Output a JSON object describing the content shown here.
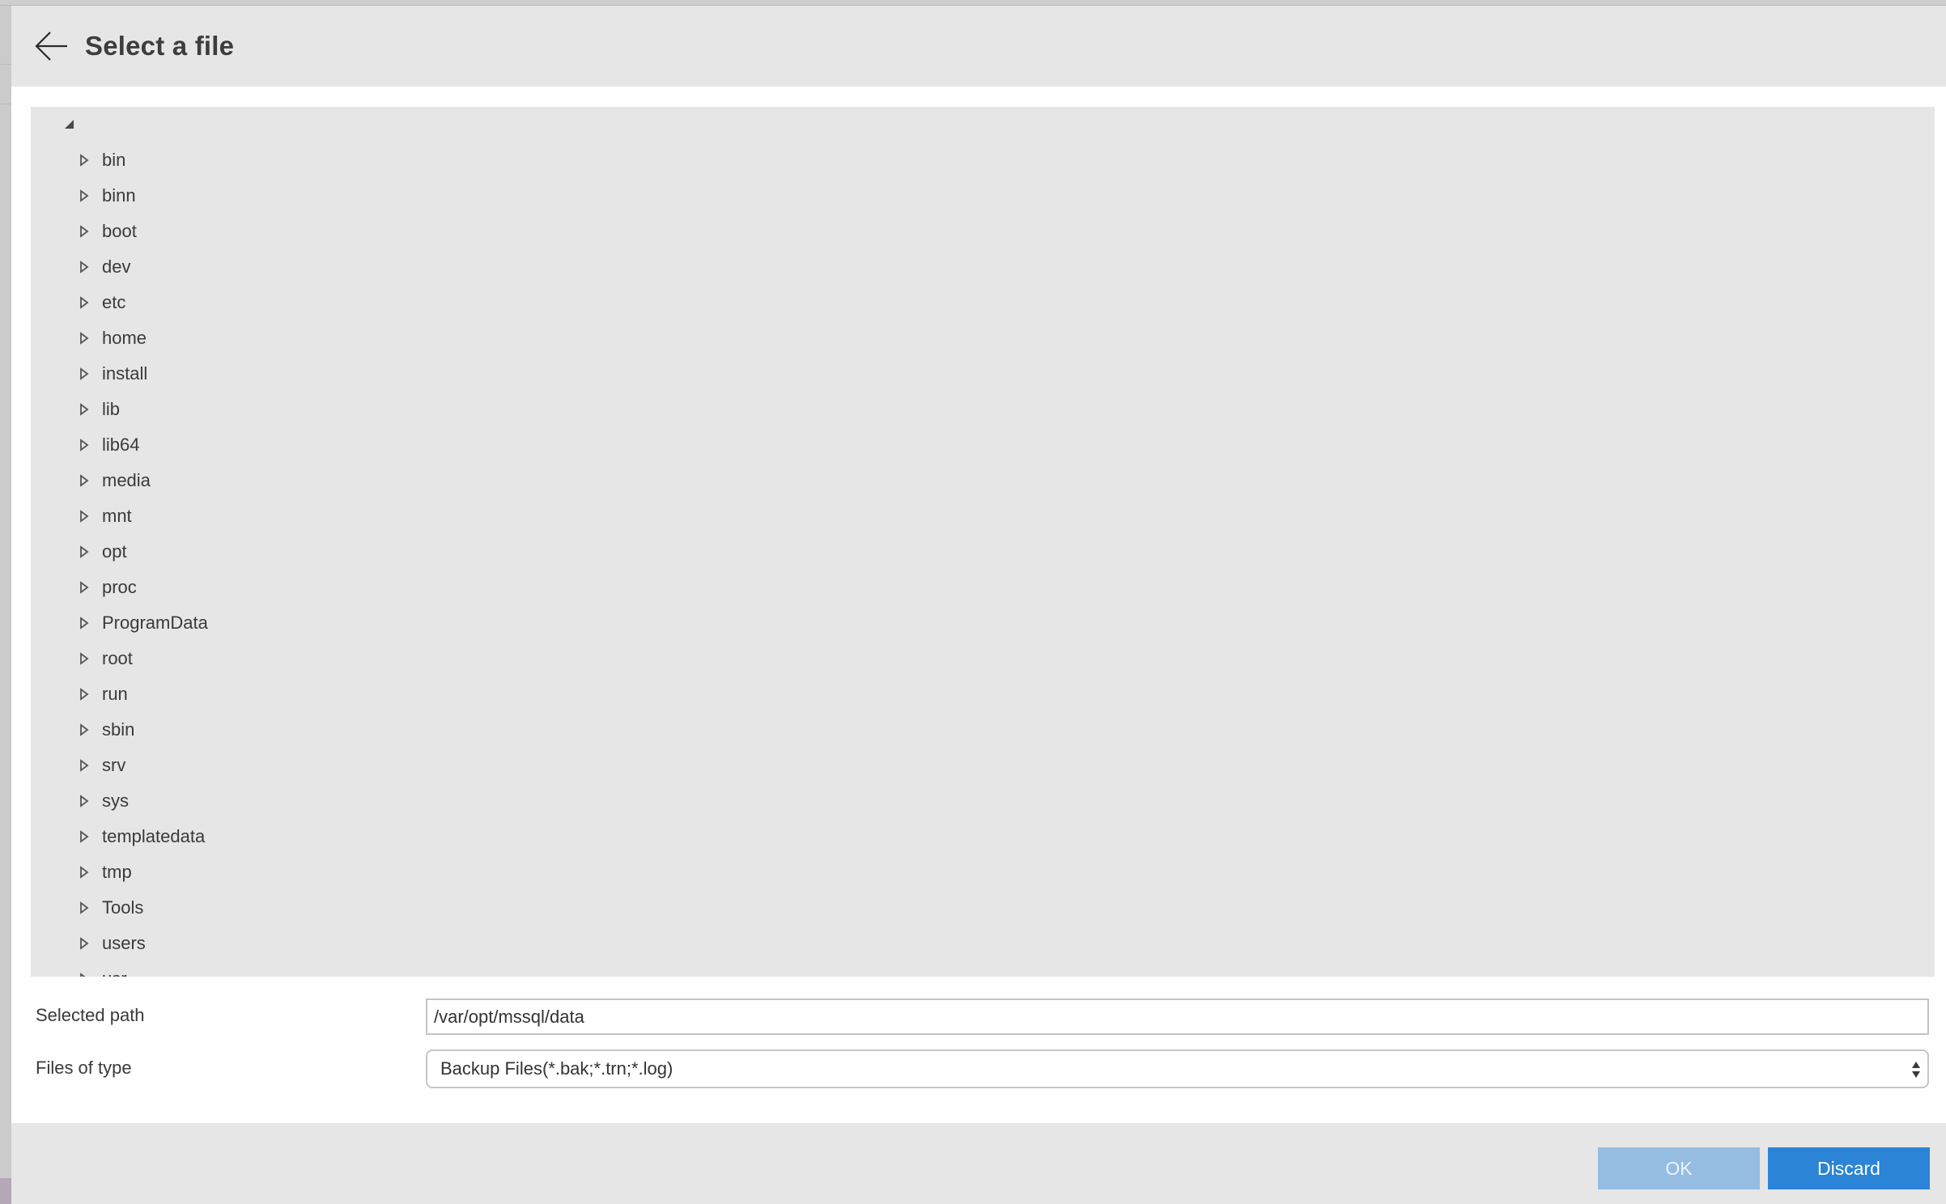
{
  "header": {
    "title": "Select a file",
    "back_icon": "arrow-left-icon"
  },
  "tree": {
    "root": {
      "expanded": true,
      "label": ""
    },
    "items": [
      {
        "label": "bin"
      },
      {
        "label": "binn"
      },
      {
        "label": "boot"
      },
      {
        "label": "dev"
      },
      {
        "label": "etc"
      },
      {
        "label": "home"
      },
      {
        "label": "install"
      },
      {
        "label": "lib"
      },
      {
        "label": "lib64"
      },
      {
        "label": "media"
      },
      {
        "label": "mnt"
      },
      {
        "label": "opt"
      },
      {
        "label": "proc"
      },
      {
        "label": "ProgramData"
      },
      {
        "label": "root"
      },
      {
        "label": "run"
      },
      {
        "label": "sbin"
      },
      {
        "label": "srv"
      },
      {
        "label": "sys"
      },
      {
        "label": "templatedata"
      },
      {
        "label": "tmp"
      },
      {
        "label": "Tools"
      },
      {
        "label": "users"
      },
      {
        "label": "usr"
      }
    ]
  },
  "form": {
    "selected_path_label": "Selected path",
    "selected_path_value": "/var/opt/mssql/data",
    "files_of_type_label": "Files of type",
    "files_of_type_value": "Backup Files(*.bak;*.trn;*.log)"
  },
  "footer": {
    "ok_label": "OK",
    "discard_label": "Discard",
    "ok_enabled": false
  },
  "colors": {
    "accent": "#2b84d6",
    "accent_disabled": "#95bde1",
    "panel": "#e6e6e6"
  }
}
